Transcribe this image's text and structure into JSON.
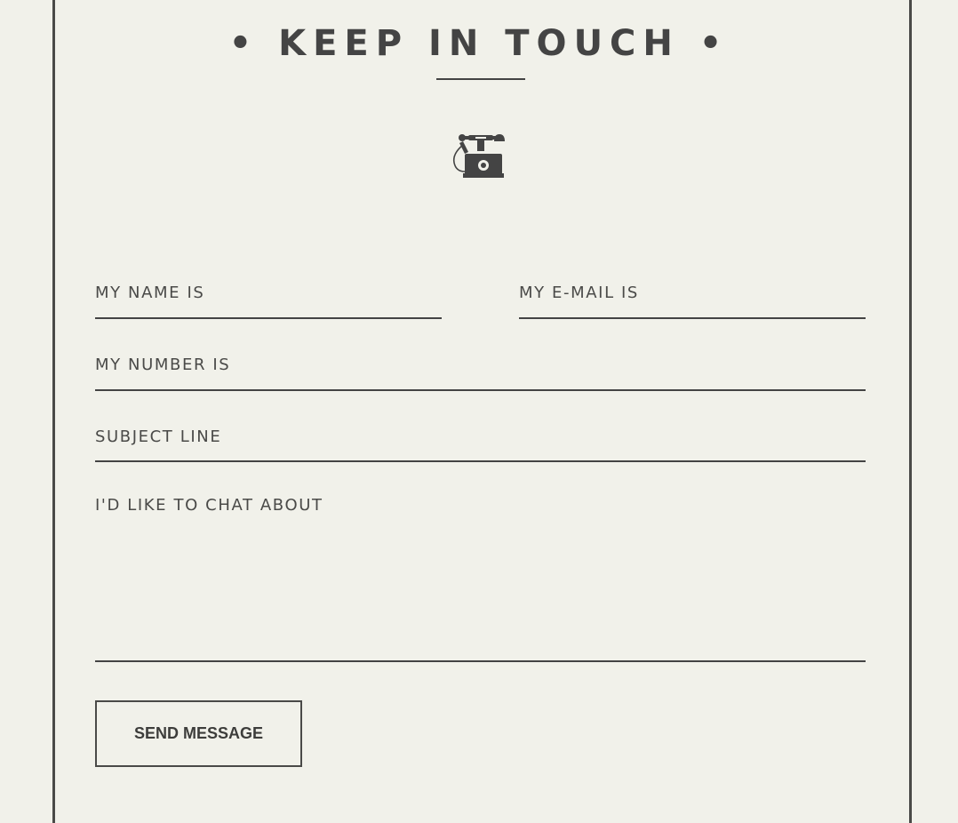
{
  "contact": {
    "heading": "• KEEP IN TOUCH •",
    "icon": "vintage-telephone-icon",
    "fields": {
      "name_placeholder": "MY NAME IS",
      "email_placeholder": "MY E-MAIL IS",
      "number_placeholder": "MY NUMBER IS",
      "subject_placeholder": "SUBJECT LINE",
      "message_placeholder": "I'D LIKE TO CHAT ABOUT"
    },
    "send_label": "SEND MESSAGE"
  },
  "colors": {
    "background": "#f1f1ea",
    "ink": "#444444"
  }
}
